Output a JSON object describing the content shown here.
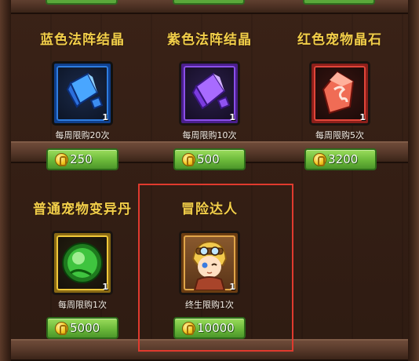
{
  "shop": {
    "items": [
      {
        "name": "蓝色法阵结晶",
        "quantity": "1",
        "limit": "每周限购20次",
        "price": "250",
        "icon": "blue-crystal-icon",
        "frame_color": "#1e6fd9"
      },
      {
        "name": "紫色法阵结晶",
        "quantity": "1",
        "limit": "每周限购10次",
        "price": "500",
        "icon": "purple-crystal-icon",
        "frame_color": "#7a3cd9"
      },
      {
        "name": "红色宠物晶石",
        "quantity": "1",
        "limit": "每周限购5次",
        "price": "3200",
        "icon": "red-pet-gem-icon",
        "frame_color": "#d0352c"
      },
      {
        "name": "普通宠物变异丹",
        "quantity": "1",
        "limit": "每周限购1次",
        "price": "5000",
        "icon": "green-pill-icon",
        "frame_color": "#d9b324"
      },
      {
        "name": "冒险达人",
        "quantity": "1",
        "limit": "终生限购1次",
        "price": "10000",
        "icon": "adventurer-avatar-icon",
        "frame_color": "#c98c2a"
      }
    ],
    "currency_icon": "gold-coin-icon",
    "highlight_color": "#e03a2e"
  }
}
